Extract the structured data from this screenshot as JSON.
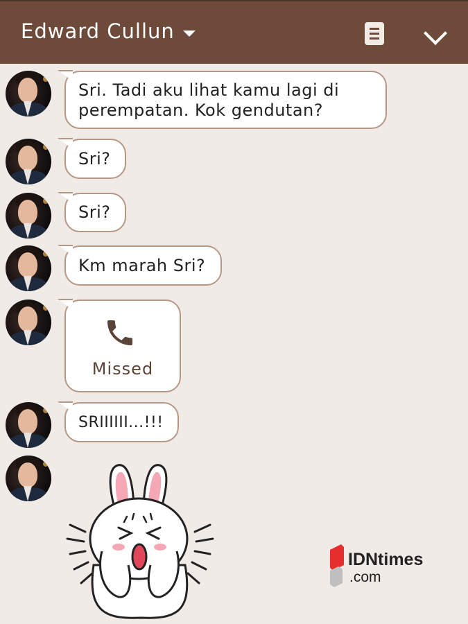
{
  "header": {
    "title": "Edward Cullun",
    "dropdown_icon": "caret-down-icon",
    "note_icon": "note-icon",
    "collapse_icon": "chevron-down-icon",
    "background": "#6e4a3a"
  },
  "chat": {
    "messages": [
      {
        "type": "text",
        "line1": "Sri. Tadi aku lihat kamu lagi di",
        "line2": "perempatan. Kok gendutan?"
      },
      {
        "type": "text",
        "text": "Sri?"
      },
      {
        "type": "text",
        "text": "Sri?"
      },
      {
        "type": "text",
        "text": "Km marah Sri?"
      },
      {
        "type": "call",
        "icon": "phone-icon",
        "label": "Missed"
      },
      {
        "type": "text",
        "text": "SRIIIIII...!!!"
      },
      {
        "type": "sticker",
        "icon": "crying-bunny-sticker"
      }
    ]
  },
  "watermark": {
    "brand": "IDNtimes",
    "domain": ".com"
  },
  "colors": {
    "background": "#f0ebe6",
    "bubble_border": "#b59786"
  }
}
